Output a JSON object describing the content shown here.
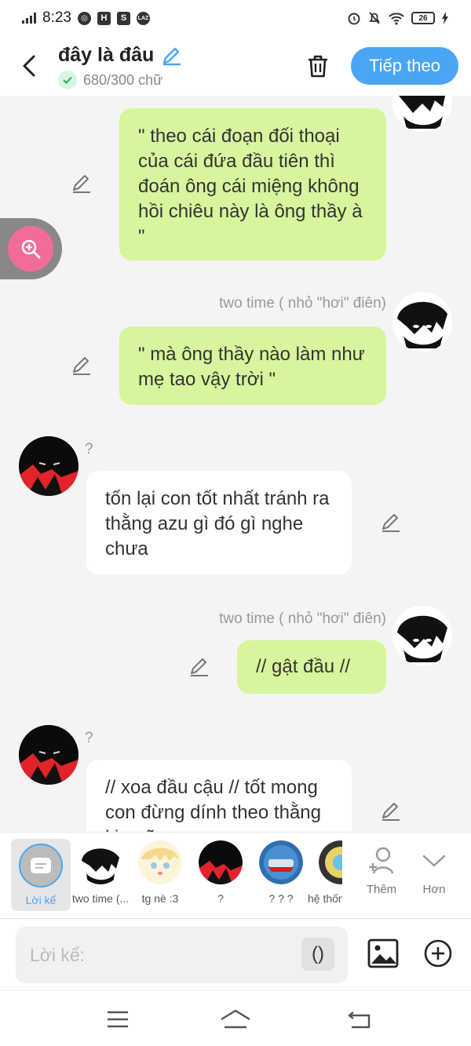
{
  "status": {
    "time": "8:23",
    "battery": "26"
  },
  "header": {
    "title": "đây là đâu",
    "word_count": "680/300 chữ",
    "next_label": "Tiếp theo"
  },
  "messages": [
    {
      "text": "\" theo cái đoạn đối thoại của cái đứa đầu tiên thì đoán ông cái miệng không hồi chiêu này là ông thầy à \""
    },
    {
      "name": "two time ( nhỏ \"hơi\" điên)",
      "text": "\" mà ông thầy nào làm như mẹ tao vậy trời \""
    },
    {
      "name": "?",
      "text": "tốn lại con tốt nhất tránh ra thằng azu gì đó gì nghe chưa"
    },
    {
      "name": "two time ( nhỏ \"hơi\" điên)",
      "text": "// gật đầu //"
    },
    {
      "name": "?",
      "text": "// xoa đầu cậu // tốt mong con đừng dính theo thằng kia nữa"
    }
  ],
  "characters": [
    {
      "label": "Lời kể"
    },
    {
      "label": "two time (..."
    },
    {
      "label": "tg nè :3"
    },
    {
      "label": "?"
    },
    {
      "label": "? ? ?"
    },
    {
      "label": "hệ thống"
    }
  ],
  "tools": {
    "add_label": "Thêm",
    "more_label": "Hơn"
  },
  "input": {
    "placeholder": "Lời kể:",
    "paren": "()"
  },
  "colors": {
    "accent": "#4aa6f5",
    "bubble_green": "#d6f59c",
    "zoom_pink": "#f26c9a"
  }
}
